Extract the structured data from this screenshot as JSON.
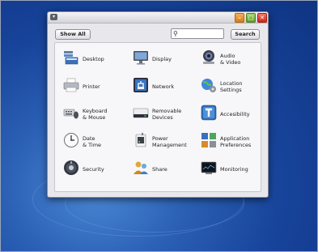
{
  "window": {
    "menu_glyph": "▾",
    "min_glyph": "–",
    "max_glyph": "□",
    "close_glyph": "✕"
  },
  "toolbar": {
    "show_all_label": "Show All",
    "search_label": "Search",
    "search_value": "",
    "search_placeholder": ""
  },
  "items": [
    {
      "label": "Desktop",
      "icon": "desktop-icon"
    },
    {
      "label": "Display",
      "icon": "display-icon"
    },
    {
      "label": "Audio\n& Video",
      "icon": "audio-video-icon"
    },
    {
      "label": "Printer",
      "icon": "printer-icon"
    },
    {
      "label": "Network",
      "icon": "network-icon"
    },
    {
      "label": "Location\nSettings",
      "icon": "location-settings-icon"
    },
    {
      "label": "Keyboard\n& Mouse",
      "icon": "keyboard-mouse-icon"
    },
    {
      "label": "Removable\nDevices",
      "icon": "removable-devices-icon"
    },
    {
      "label": "Accesibility",
      "icon": "accessibility-icon"
    },
    {
      "label": "Date\n& Time",
      "icon": "clock-icon"
    },
    {
      "label": "Power\nManagement",
      "icon": "power-management-icon"
    },
    {
      "label": "Application\nPreferences",
      "icon": "application-preferences-icon"
    },
    {
      "label": "Security",
      "icon": "security-icon"
    },
    {
      "label": "Share",
      "icon": "share-icon"
    },
    {
      "label": "Monitoring",
      "icon": "monitoring-icon"
    }
  ]
}
